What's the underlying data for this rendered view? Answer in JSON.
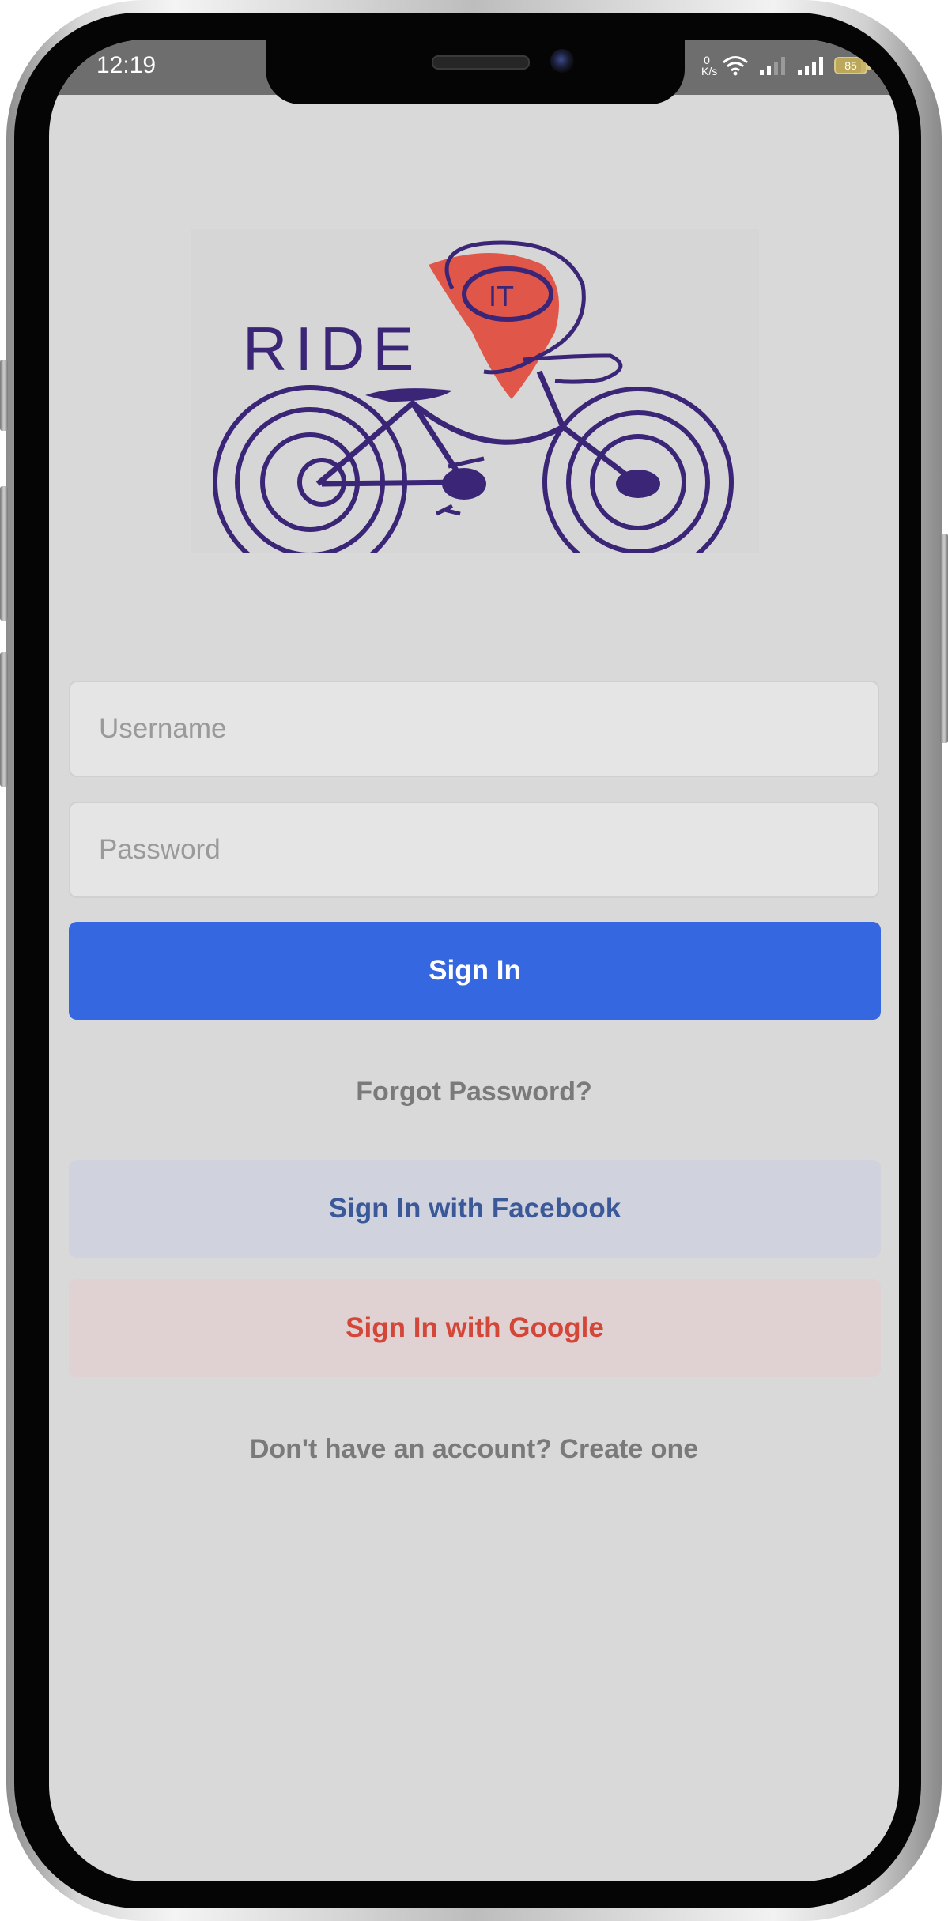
{
  "status_bar": {
    "time": "12:19",
    "network_speed": "0\nK/s",
    "battery_level": "85"
  },
  "logo": {
    "brand_top": "IT",
    "brand_main": "RIDE"
  },
  "login_form": {
    "username_placeholder": "Username",
    "password_placeholder": "Password",
    "sign_in_label": "Sign In",
    "forgot_password_label": "Forgot Password?",
    "facebook_label": "Sign In with Facebook",
    "google_label": "Sign In with Google",
    "create_account_label": "Don't have an account? Create one"
  },
  "colors": {
    "screen_background": "#d9d9d9",
    "primary_button": "#3567e0",
    "facebook_text": "#3b5998",
    "facebook_background": "#d0d3dd",
    "google_text": "#d44638",
    "google_background": "#e0d1d3",
    "logo_ink": "#3a2577",
    "logo_pin": "#e0574a"
  },
  "icons": {
    "wifi": "wifi-icon",
    "signal_1": "cell-signal-icon",
    "signal_2": "cell-signal-icon",
    "battery": "battery-icon"
  }
}
